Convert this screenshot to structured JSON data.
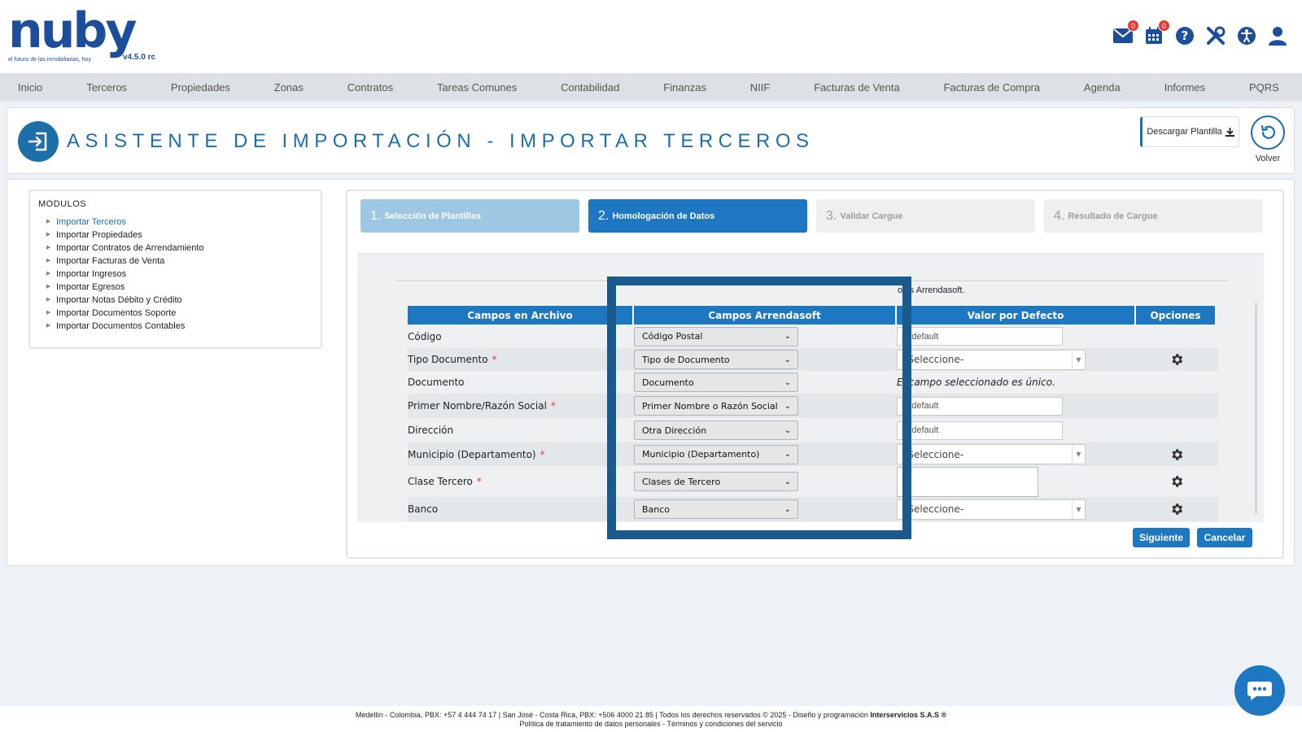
{
  "brand": {
    "name": "nuby",
    "tagline": "el futuro de las inmobiliarias, hoy",
    "version": "v4.5.0 rc",
    "color": "#1c4e9b"
  },
  "header_icons": [
    {
      "icon": "mail-icon",
      "badge": "0"
    },
    {
      "icon": "calendar-icon",
      "badge": "0"
    },
    {
      "icon": "help-icon"
    },
    {
      "icon": "tools-icon"
    },
    {
      "icon": "accessibility-icon"
    },
    {
      "icon": "user-icon"
    }
  ],
  "nav": [
    "Inicio",
    "Terceros",
    "Propiedades",
    "Zonas",
    "Contratos",
    "Tareas Comunes",
    "Contabilidad",
    "Finanzas",
    "NIIF",
    "Facturas de Venta",
    "Facturas de Compra",
    "Agenda",
    "Informes",
    "PQRS"
  ],
  "page": {
    "title": "ASISTENTE DE IMPORTACIÓN - IMPORTAR TERCEROS",
    "download_label": "Descargar Plantilla",
    "back_label": "Volver"
  },
  "modules": {
    "title": "MODULOS",
    "items": [
      "Importar Terceros",
      "Importar Propiedades",
      "Importar Contratos de Arrendamiento",
      "Importar Facturas de Venta",
      "Importar Ingresos",
      "Importar Egresos",
      "Importar Notas Débito y Crédito",
      "Importar Documentos Soporte",
      "Importar Documentos Contables"
    ],
    "active": "Importar Terceros"
  },
  "steps": [
    {
      "num": "1.",
      "label": "Selección de Plantillas",
      "state": "done"
    },
    {
      "num": "2.",
      "label": "Homologación de Datos",
      "state": "active"
    },
    {
      "num": "3.",
      "label": "Validar Cargue",
      "state": "pending"
    },
    {
      "num": "4.",
      "label": "Resultado de Cargue",
      "state": "pending"
    }
  ],
  "info_text": "o vs Arrendasoft.",
  "table": {
    "headers": [
      "Campos en Archivo",
      "Campos Arrendasoft",
      "Valor por Defecto",
      "Opciones"
    ],
    "rows": [
      {
        "field": "Código",
        "required": false,
        "mapped": "Código Postal",
        "default_type": "input",
        "default": "[0]default"
      },
      {
        "field": "Tipo Documento",
        "required": true,
        "mapped": "Tipo de Documento",
        "default_type": "dropdown",
        "default": "-Seleccione-",
        "gear": true
      },
      {
        "field": "Documento",
        "required": false,
        "mapped": "Documento",
        "default_type": "note",
        "default": "El campo seleccionado es único."
      },
      {
        "field": "Primer Nombre/Razón Social",
        "required": true,
        "mapped": "Primer Nombre o Razón Social",
        "default_type": "input",
        "default": "[3]default"
      },
      {
        "field": "Dirección",
        "required": false,
        "mapped": "Otra Dirección",
        "default_type": "input",
        "default": "[4]default"
      },
      {
        "field": "Municipio (Departamento)",
        "required": true,
        "mapped": "Municipio (Departamento)",
        "default_type": "dropdown",
        "default": "-Seleccione-",
        "gear": true
      },
      {
        "field": "Clase Tercero",
        "required": true,
        "mapped": "Clases de Tercero",
        "default_type": "textarea",
        "default": "",
        "gear": true
      },
      {
        "field": "Banco",
        "required": false,
        "mapped": "Banco",
        "default_type": "dropdown",
        "default": "-Seleccione-",
        "gear": true
      }
    ]
  },
  "buttons": {
    "next": "Siguiente",
    "cancel": "Cancelar"
  },
  "footer": {
    "line1_prefix": "Medellín - Colombia, PBX: +57 4 444 74 17 | San José - Costa Rica, PBX: +506 4000 21 85 | Todos los derechos reservados © 2025 - Diseño y programación ",
    "line1_company": "Interservicios S.A.S ®",
    "line2": "Política de tratamiento de datos personales - Términos y condiciones del servicio"
  },
  "colors": {
    "primary": "#1d78c1",
    "title": "#1d6faa",
    "required": "#e53935",
    "highlight": "#1a5a8d"
  }
}
